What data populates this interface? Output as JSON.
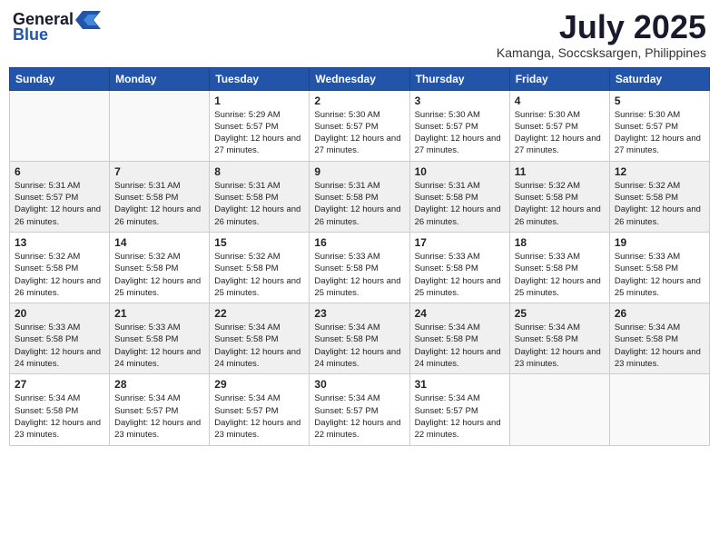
{
  "header": {
    "logo_general": "General",
    "logo_blue": "Blue",
    "month_year": "July 2025",
    "location": "Kamanga, Soccsksargen, Philippines"
  },
  "weekdays": [
    "Sunday",
    "Monday",
    "Tuesday",
    "Wednesday",
    "Thursday",
    "Friday",
    "Saturday"
  ],
  "weeks": [
    [
      {
        "day": "",
        "info": ""
      },
      {
        "day": "",
        "info": ""
      },
      {
        "day": "1",
        "info": "Sunrise: 5:29 AM\nSunset: 5:57 PM\nDaylight: 12 hours and 27 minutes."
      },
      {
        "day": "2",
        "info": "Sunrise: 5:30 AM\nSunset: 5:57 PM\nDaylight: 12 hours and 27 minutes."
      },
      {
        "day": "3",
        "info": "Sunrise: 5:30 AM\nSunset: 5:57 PM\nDaylight: 12 hours and 27 minutes."
      },
      {
        "day": "4",
        "info": "Sunrise: 5:30 AM\nSunset: 5:57 PM\nDaylight: 12 hours and 27 minutes."
      },
      {
        "day": "5",
        "info": "Sunrise: 5:30 AM\nSunset: 5:57 PM\nDaylight: 12 hours and 27 minutes."
      }
    ],
    [
      {
        "day": "6",
        "info": "Sunrise: 5:31 AM\nSunset: 5:57 PM\nDaylight: 12 hours and 26 minutes."
      },
      {
        "day": "7",
        "info": "Sunrise: 5:31 AM\nSunset: 5:58 PM\nDaylight: 12 hours and 26 minutes."
      },
      {
        "day": "8",
        "info": "Sunrise: 5:31 AM\nSunset: 5:58 PM\nDaylight: 12 hours and 26 minutes."
      },
      {
        "day": "9",
        "info": "Sunrise: 5:31 AM\nSunset: 5:58 PM\nDaylight: 12 hours and 26 minutes."
      },
      {
        "day": "10",
        "info": "Sunrise: 5:31 AM\nSunset: 5:58 PM\nDaylight: 12 hours and 26 minutes."
      },
      {
        "day": "11",
        "info": "Sunrise: 5:32 AM\nSunset: 5:58 PM\nDaylight: 12 hours and 26 minutes."
      },
      {
        "day": "12",
        "info": "Sunrise: 5:32 AM\nSunset: 5:58 PM\nDaylight: 12 hours and 26 minutes."
      }
    ],
    [
      {
        "day": "13",
        "info": "Sunrise: 5:32 AM\nSunset: 5:58 PM\nDaylight: 12 hours and 26 minutes."
      },
      {
        "day": "14",
        "info": "Sunrise: 5:32 AM\nSunset: 5:58 PM\nDaylight: 12 hours and 25 minutes."
      },
      {
        "day": "15",
        "info": "Sunrise: 5:32 AM\nSunset: 5:58 PM\nDaylight: 12 hours and 25 minutes."
      },
      {
        "day": "16",
        "info": "Sunrise: 5:33 AM\nSunset: 5:58 PM\nDaylight: 12 hours and 25 minutes."
      },
      {
        "day": "17",
        "info": "Sunrise: 5:33 AM\nSunset: 5:58 PM\nDaylight: 12 hours and 25 minutes."
      },
      {
        "day": "18",
        "info": "Sunrise: 5:33 AM\nSunset: 5:58 PM\nDaylight: 12 hours and 25 minutes."
      },
      {
        "day": "19",
        "info": "Sunrise: 5:33 AM\nSunset: 5:58 PM\nDaylight: 12 hours and 25 minutes."
      }
    ],
    [
      {
        "day": "20",
        "info": "Sunrise: 5:33 AM\nSunset: 5:58 PM\nDaylight: 12 hours and 24 minutes."
      },
      {
        "day": "21",
        "info": "Sunrise: 5:33 AM\nSunset: 5:58 PM\nDaylight: 12 hours and 24 minutes."
      },
      {
        "day": "22",
        "info": "Sunrise: 5:34 AM\nSunset: 5:58 PM\nDaylight: 12 hours and 24 minutes."
      },
      {
        "day": "23",
        "info": "Sunrise: 5:34 AM\nSunset: 5:58 PM\nDaylight: 12 hours and 24 minutes."
      },
      {
        "day": "24",
        "info": "Sunrise: 5:34 AM\nSunset: 5:58 PM\nDaylight: 12 hours and 24 minutes."
      },
      {
        "day": "25",
        "info": "Sunrise: 5:34 AM\nSunset: 5:58 PM\nDaylight: 12 hours and 23 minutes."
      },
      {
        "day": "26",
        "info": "Sunrise: 5:34 AM\nSunset: 5:58 PM\nDaylight: 12 hours and 23 minutes."
      }
    ],
    [
      {
        "day": "27",
        "info": "Sunrise: 5:34 AM\nSunset: 5:58 PM\nDaylight: 12 hours and 23 minutes."
      },
      {
        "day": "28",
        "info": "Sunrise: 5:34 AM\nSunset: 5:57 PM\nDaylight: 12 hours and 23 minutes."
      },
      {
        "day": "29",
        "info": "Sunrise: 5:34 AM\nSunset: 5:57 PM\nDaylight: 12 hours and 23 minutes."
      },
      {
        "day": "30",
        "info": "Sunrise: 5:34 AM\nSunset: 5:57 PM\nDaylight: 12 hours and 22 minutes."
      },
      {
        "day": "31",
        "info": "Sunrise: 5:34 AM\nSunset: 5:57 PM\nDaylight: 12 hours and 22 minutes."
      },
      {
        "day": "",
        "info": ""
      },
      {
        "day": "",
        "info": ""
      }
    ]
  ]
}
